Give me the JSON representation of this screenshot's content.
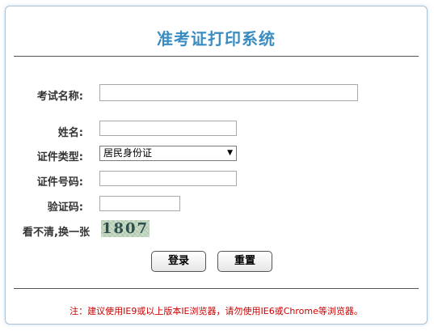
{
  "page": {
    "title": "准考证打印系统"
  },
  "form": {
    "exam_name_label": "考试名称:",
    "exam_name_value": "",
    "name_label": "姓名:",
    "name_value": "",
    "id_type_label": "证件类型:",
    "id_type_selected": "居民身份证",
    "id_number_label": "证件号码:",
    "id_number_value": "",
    "captcha_label": "验证码:",
    "captcha_value": "",
    "captcha_refresh_label": "看不清,换一张",
    "captcha_text": "1807"
  },
  "buttons": {
    "login_label": "登录",
    "reset_label": "重置"
  },
  "notice": {
    "text": "注：建议使用IE9或以上版本IE浏览器，请勿使用IE6或Chrome等浏览器。"
  },
  "colors": {
    "title": "#3a8cc1",
    "notice": "#cc0000",
    "panel_border": "#aac3d6"
  },
  "icons": {
    "select_arrow": "dropdown-arrow-icon"
  }
}
